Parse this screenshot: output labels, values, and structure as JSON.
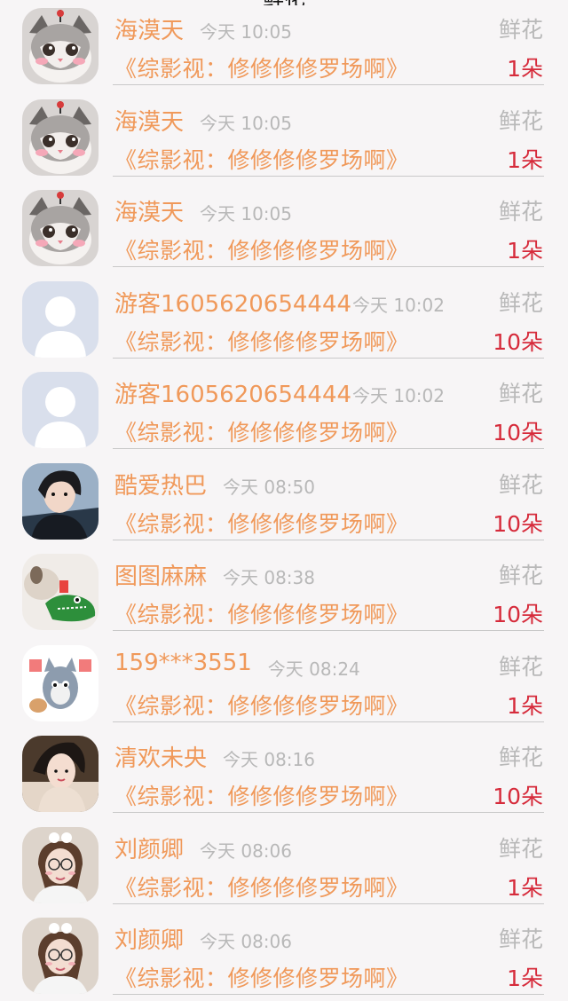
{
  "header": {
    "title_fragment": "鲜花"
  },
  "gifts": [
    {
      "name": "海漠天",
      "time": "今天 10:05",
      "type": "鲜花",
      "title": "《综影视：修修修修罗场啊》",
      "count": "1朵",
      "avatar": "cat"
    },
    {
      "name": "海漠天",
      "time": "今天 10:05",
      "type": "鲜花",
      "title": "《综影视：修修修修罗场啊》",
      "count": "1朵",
      "avatar": "cat"
    },
    {
      "name": "海漠天",
      "time": "今天 10:05",
      "type": "鲜花",
      "title": "《综影视：修修修修罗场啊》",
      "count": "1朵",
      "avatar": "cat"
    },
    {
      "name": "游客1605620654444",
      "time": "今天 10:02",
      "type": "鲜花",
      "title": "《综影视：修修修修罗场啊》",
      "count": "10朵",
      "avatar": "default-user"
    },
    {
      "name": "游客1605620654444",
      "time": "今天 10:02",
      "type": "鲜花",
      "title": "《综影视：修修修修罗场啊》",
      "count": "10朵",
      "avatar": "default-user"
    },
    {
      "name": "酷爱热巴",
      "time": "今天 08:50",
      "type": "鲜花",
      "title": "《综影视：修修修修罗场啊》",
      "count": "10朵",
      "avatar": "woman-dark"
    },
    {
      "name": "图图麻麻",
      "time": "今天 08:38",
      "type": "鲜花",
      "title": "《综影视：修修修修罗场啊》",
      "count": "10朵",
      "avatar": "dog-toy"
    },
    {
      "name": "159***3551",
      "time": "今天 08:24",
      "type": "鲜花",
      "title": "《综影视：修修修修罗场啊》",
      "count": "1朵",
      "avatar": "cartoon-cat"
    },
    {
      "name": "清欢未央",
      "time": "今天 08:16",
      "type": "鲜花",
      "title": "《综影视：修修修修罗场啊》",
      "count": "10朵",
      "avatar": "woman-costume"
    },
    {
      "name": "刘颜卿",
      "time": "今天 08:06",
      "type": "鲜花",
      "title": "《综影视：修修修修罗场啊》",
      "count": "1朵",
      "avatar": "girl-glasses"
    },
    {
      "name": "刘颜卿",
      "time": "今天 08:06",
      "type": "鲜花",
      "title": "《综影视：修修修修罗场啊》",
      "count": "1朵",
      "avatar": "girl-glasses"
    }
  ],
  "colors": {
    "name": "#f0995a",
    "title": "#f0995a",
    "count": "#d62b3b",
    "meta": "#b8b8b8",
    "background": "#f7f5f6"
  }
}
